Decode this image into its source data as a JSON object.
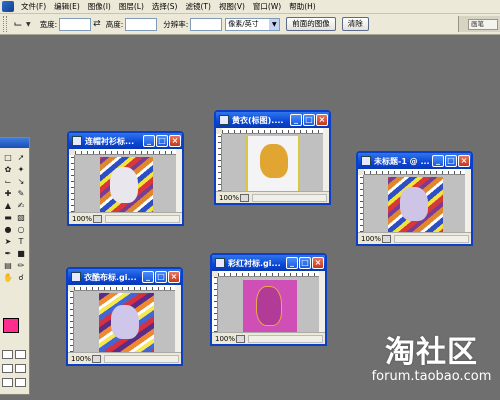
{
  "menubar": {
    "items": [
      "文件(F)",
      "编辑(E)",
      "图像(I)",
      "图层(L)",
      "选择(S)",
      "滤镜(T)",
      "视图(V)",
      "窗口(W)",
      "帮助(H)"
    ]
  },
  "options_bar": {
    "tool_icon": "crop-icon",
    "width_label": "宽度:",
    "width_value": "",
    "swap_icon": "swap-icon",
    "height_label": "高度:",
    "height_value": "",
    "resolution_label": "分辨率:",
    "resolution_value": "",
    "unit_select": "像素/英寸",
    "front_image_button": "前面的图像",
    "clear_button": "清除",
    "palette_tab": "画笔"
  },
  "toolbox": {
    "foreground_color": "#ff2d8e",
    "tools": [
      "marquee-icon",
      "move-icon",
      "lasso-icon",
      "magic-wand-icon",
      "crop-icon",
      "slice-icon",
      "healing-icon",
      "brush-icon",
      "stamp-icon",
      "history-brush-icon",
      "eraser-icon",
      "gradient-icon",
      "blur-icon",
      "dodge-icon",
      "path-select-icon",
      "type-icon",
      "pen-icon",
      "shape-icon",
      "notes-icon",
      "eyedropper-icon",
      "hand-icon",
      "zoom-icon"
    ]
  },
  "documents": [
    {
      "title": "连帽衬衫标...",
      "zoom": "100%"
    },
    {
      "title": "黄衣(标图)....",
      "zoom": "100%"
    },
    {
      "title": "未标题-1 @ ...",
      "zoom": "100%"
    },
    {
      "title": "衣酷布标.gi...",
      "zoom": "100%"
    },
    {
      "title": "彩红衬标.gi...",
      "zoom": "100%"
    }
  ],
  "watermark": {
    "logo": "淘社区",
    "url": "forum.taobao.com"
  },
  "colors": {
    "workspace": "#6f6f6f",
    "titlebar": "#0a46d6",
    "chrome": "#ece9d8"
  }
}
